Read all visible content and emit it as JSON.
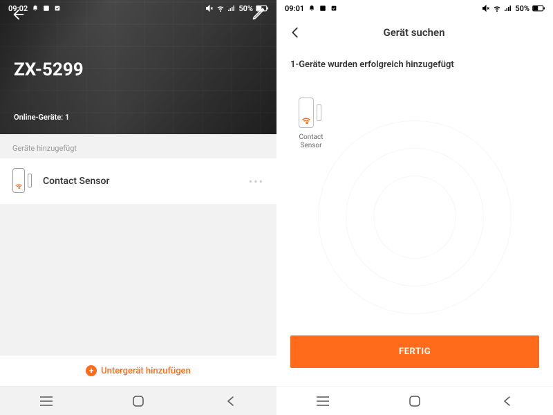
{
  "left": {
    "status": {
      "time": "09:02",
      "battery": "50%"
    },
    "hero": {
      "title": "ZX-5299",
      "subtitle": "Online-Geräte: 1"
    },
    "section_label": "Geräte hinzugefügt",
    "device": {
      "name": "Contact Sensor"
    },
    "add_subdevice": "Untergerät hinzufügen"
  },
  "right": {
    "status": {
      "time": "09:01",
      "battery": "50%"
    },
    "header_title": "Gerät suchen",
    "success_msg": "1-Geräte wurden erfolgreich hinzugefügt",
    "device_label": "Contact Sensor",
    "done_label": "FERTIG"
  },
  "colors": {
    "accent": "#ff6b1a"
  }
}
